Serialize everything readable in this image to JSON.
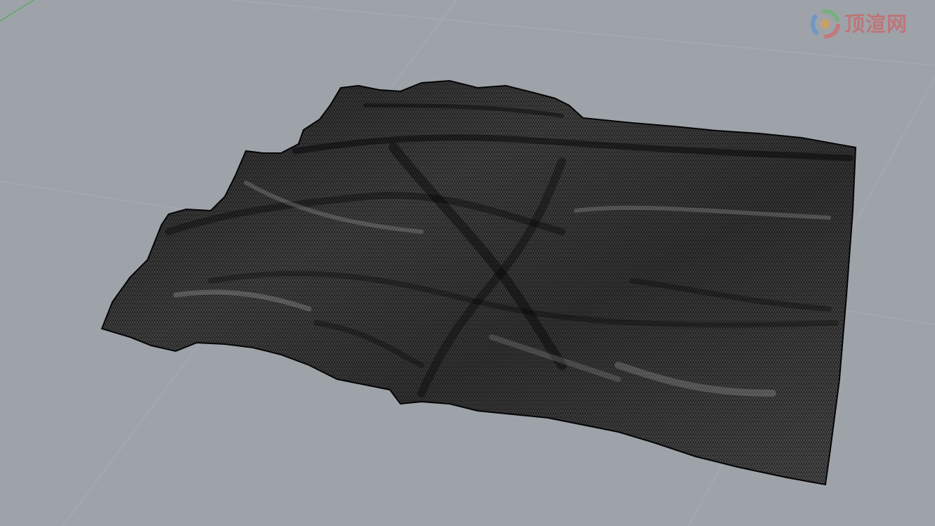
{
  "viewport": {
    "background": "#9ea3aa",
    "grid_line_color": "#a9aeb4",
    "axis_y_color": "#4caf50",
    "mesh_fill": "#3c3c3c",
    "mesh_line_color": "#0b0b0b",
    "mesh_highlight": "#8c8c8c"
  },
  "watermark": {
    "text": "顶渲网",
    "icon": "swirl-logo-icon",
    "color": "#d9534f"
  }
}
